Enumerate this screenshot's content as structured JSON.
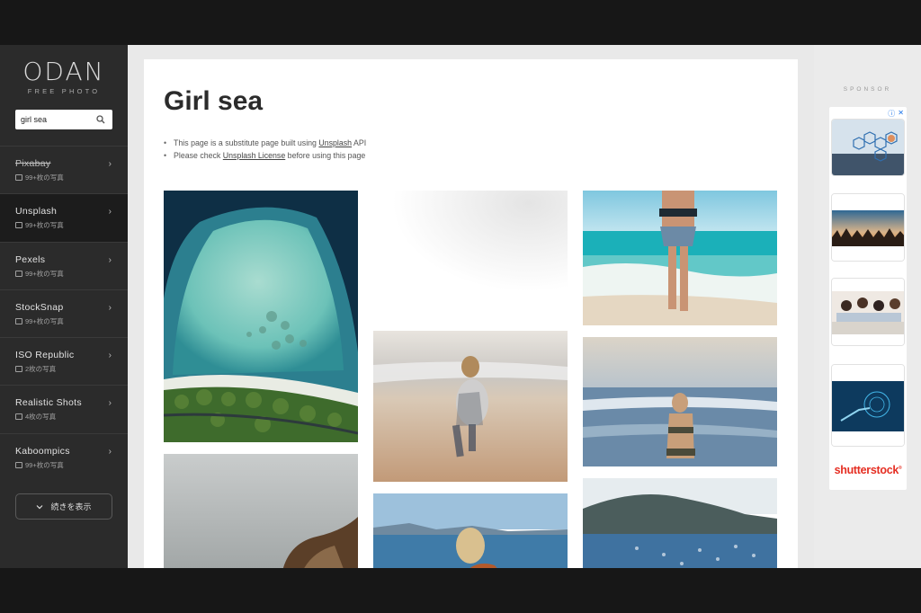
{
  "app": {
    "logo": "ODAN",
    "tagline": "FREE PHOTO"
  },
  "search": {
    "value": "girl sea",
    "icon": "search-icon"
  },
  "sources": [
    {
      "name": "Pixabay",
      "count": "99+枚の写真",
      "strike": true,
      "active": false
    },
    {
      "name": "Unsplash",
      "count": "99+枚の写真",
      "strike": false,
      "active": true
    },
    {
      "name": "Pexels",
      "count": "99+枚の写真",
      "strike": false,
      "active": false
    },
    {
      "name": "StockSnap",
      "count": "99+枚の写真",
      "strike": false,
      "active": false
    },
    {
      "name": "ISO Republic",
      "count": "2枚の写真",
      "strike": false,
      "active": false
    },
    {
      "name": "Realistic Shots",
      "count": "4枚の写真",
      "strike": false,
      "active": false
    },
    {
      "name": "Kaboompics",
      "count": "99+枚の写真",
      "strike": false,
      "active": false
    }
  ],
  "more_button": {
    "label": "続きを表示"
  },
  "main": {
    "title": "Girl sea",
    "notes": [
      {
        "prefix": "This page is a substitute page built using ",
        "link": "Unsplash",
        "suffix": " API"
      },
      {
        "prefix": "Please check ",
        "link": "Unsplash License",
        "suffix": " before using this page"
      }
    ]
  },
  "sponsor": {
    "label": "SPONSOR",
    "brand": "shutterstock",
    "brand_mark": "®"
  },
  "colors": {
    "sidebar": "#2b2b2b",
    "active_item": "#1c1c1c",
    "accent_brand": "#e52e22"
  }
}
